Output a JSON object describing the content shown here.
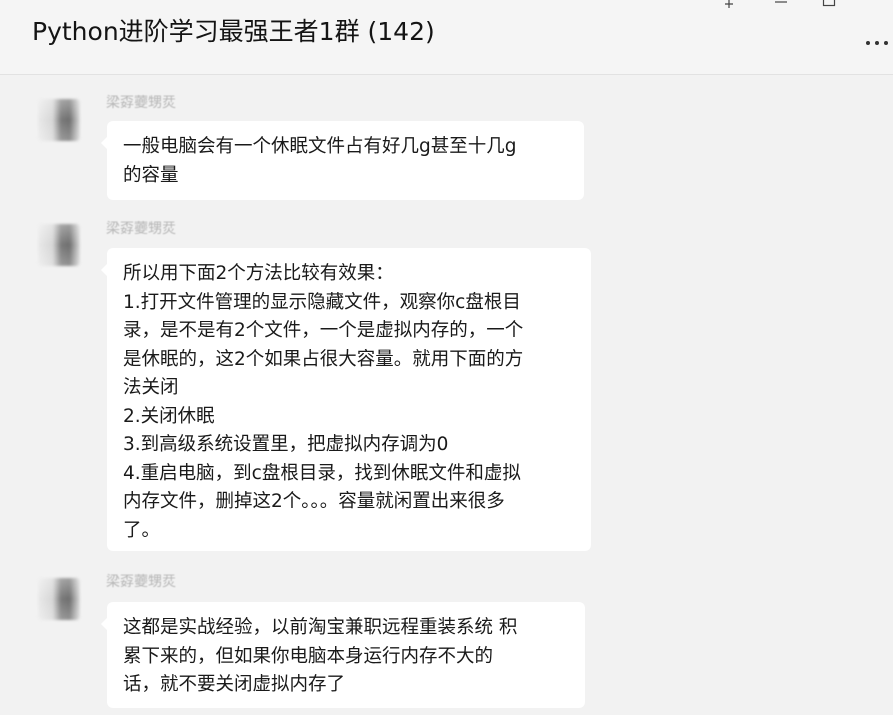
{
  "header": {
    "title": "Python进阶学习最强王者1群 (142)"
  },
  "messages": [
    {
      "sender": "梁孬蘷甥烎",
      "text": "一般电脑会有一个休眠文件占有好几g甚至十几g\n的容量"
    },
    {
      "sender": "梁孬蘷甥烎",
      "text": "所以用下面2个方法比较有效果：\n1.打开文件管理的显示隐藏文件，观察你c盘根目\n录，是不是有2个文件，一个是虚拟内存的，一个\n是休眠的，这2个如果占很大容量。就用下面的方\n法关闭\n2.关闭休眠\n3.到高级系统设置里，把虚拟内存调为0\n4.重启电脑，到c盘根目录，找到休眠文件和虚拟\n内存文件，删掉这2个。。。容量就闲置出来很多\n了。"
    },
    {
      "sender": "梁孬蘷甥烎",
      "text": "这都是实战经验，以前淘宝兼职远程重装系统 积\n累下来的，但如果你电脑本身运行内存不大的\n话，就不要关闭虚拟内存了"
    }
  ],
  "icons": {
    "pin": "pin-icon",
    "minimize": "minimize-icon",
    "maximize": "maximize-icon",
    "more": "more-icon"
  }
}
